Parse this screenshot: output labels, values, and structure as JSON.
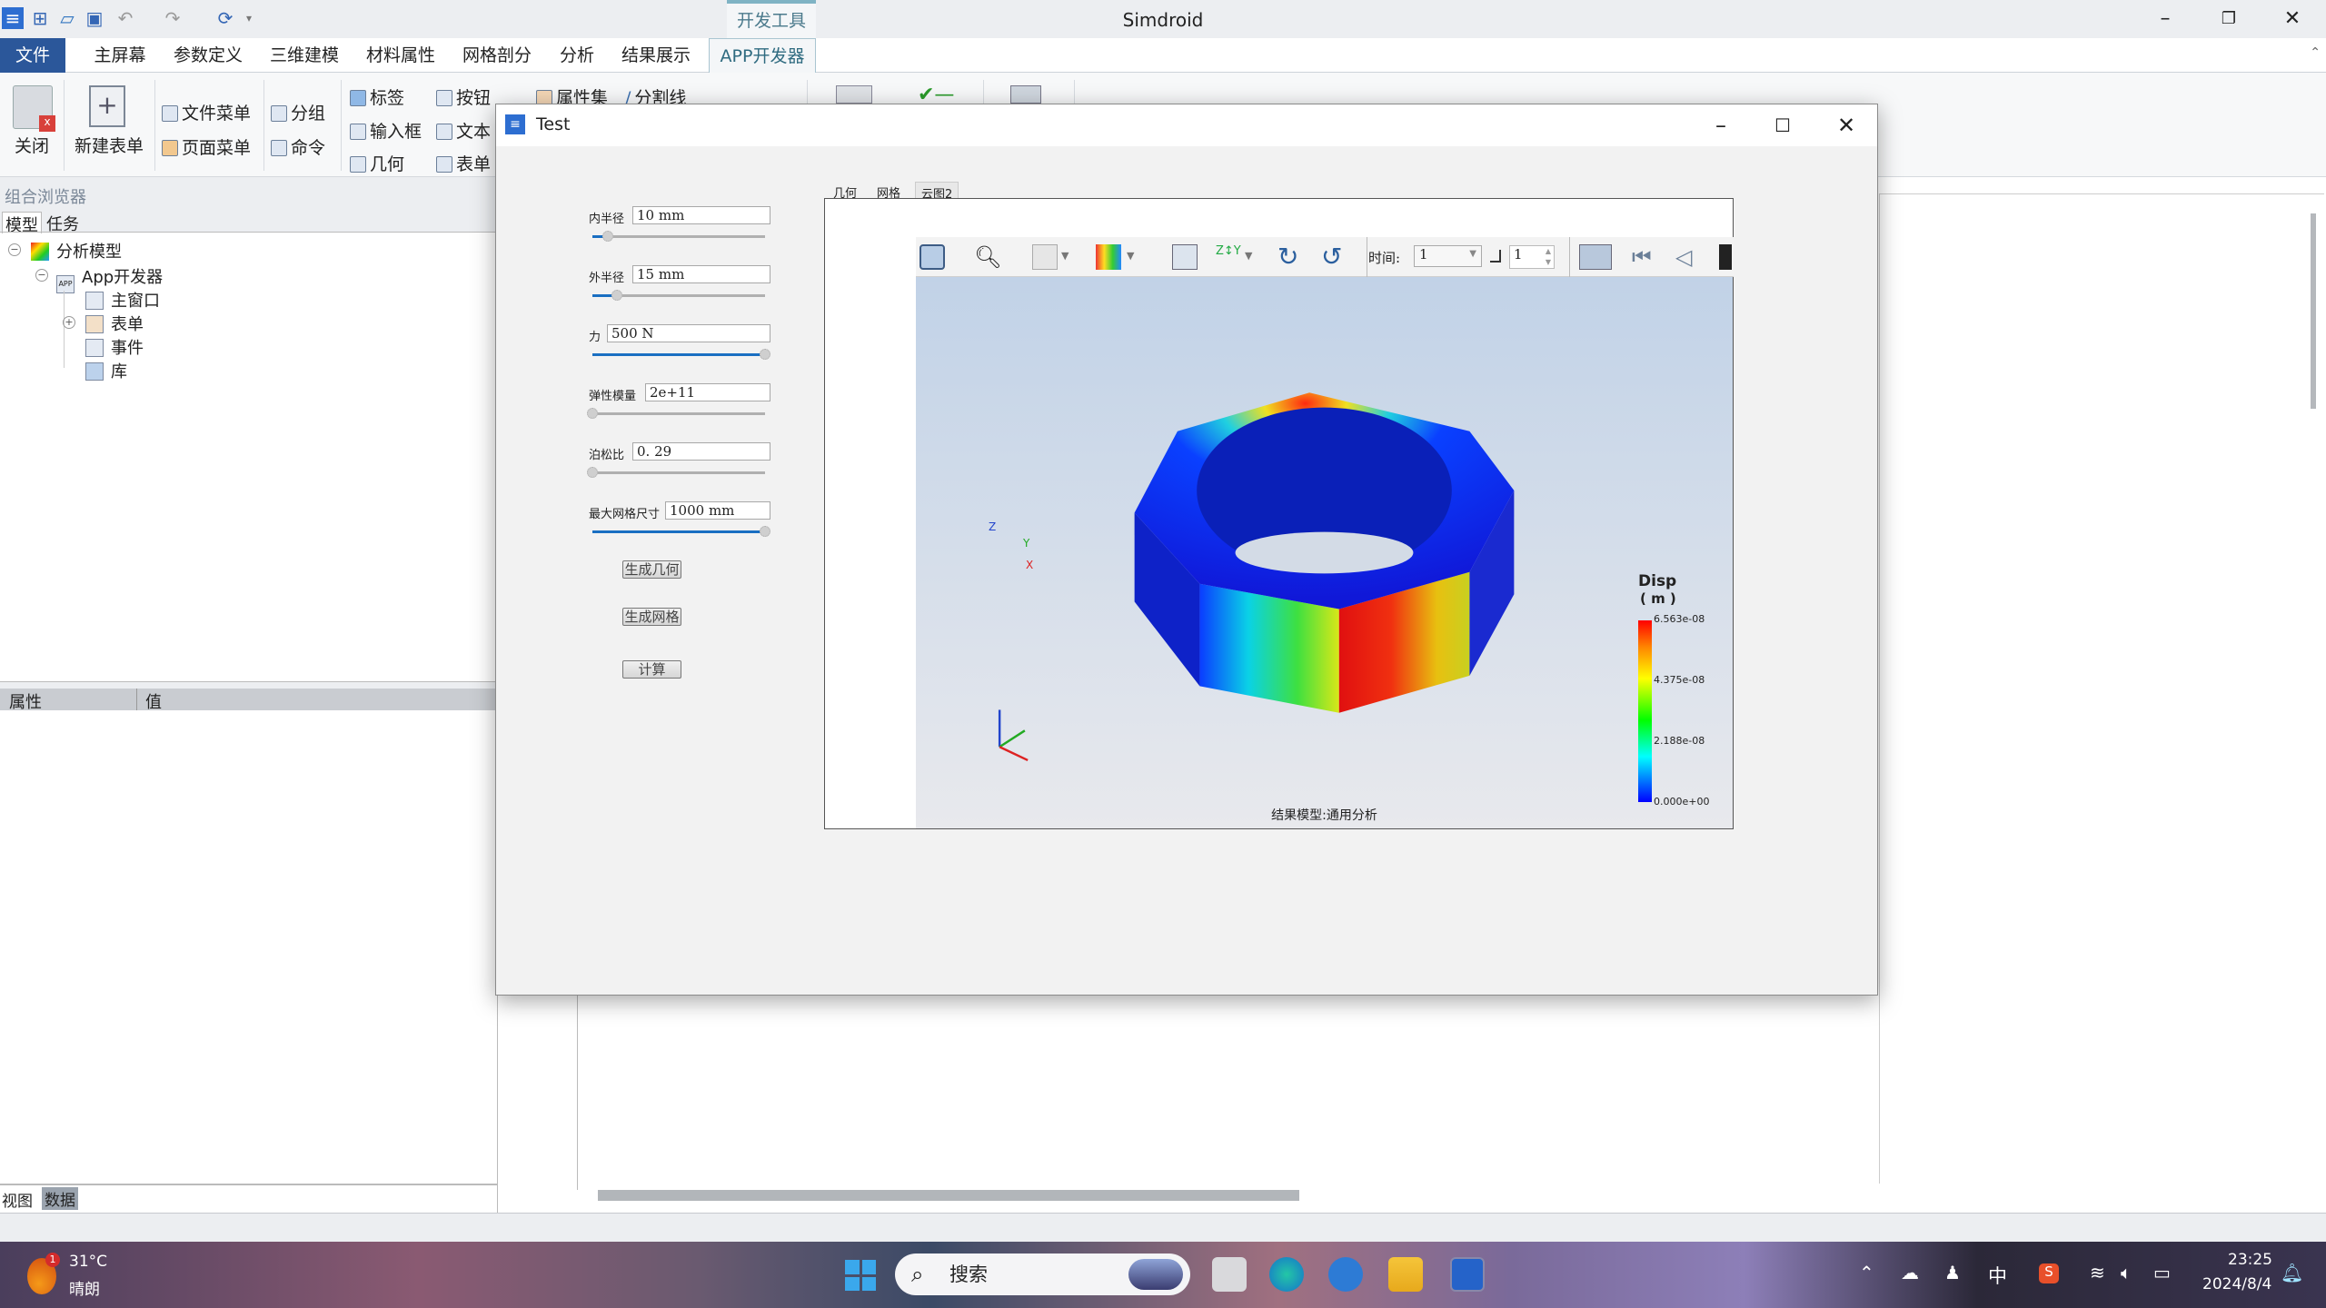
{
  "app": {
    "title": "Simdroid",
    "context_tab": "开发工具"
  },
  "menu": [
    "文件",
    "主屏幕",
    "参数定义",
    "三维建模",
    "材料属性",
    "网格剖分",
    "分析",
    "结果展示",
    "APP开发器"
  ],
  "ribbon": {
    "close": "关闭",
    "new_form": "新建表单",
    "file_menu": "文件菜单",
    "page_menu": "页面菜单",
    "group": "分组",
    "command": "命令",
    "label": "标签",
    "input_box": "输入框",
    "geometry": "几何",
    "button": "按钮",
    "text": "文本",
    "form": "表单",
    "property_set": "属性集",
    "divider": "分割线"
  },
  "left_panel": {
    "title": "组合浏览器",
    "tabs": [
      "模型",
      "任务"
    ],
    "tree": [
      {
        "label": "分析模型"
      },
      {
        "label": "App开发器"
      },
      {
        "label": "主窗口"
      },
      {
        "label": "表单"
      },
      {
        "label": "事件"
      },
      {
        "label": "库"
      }
    ],
    "prop_headers": [
      "属性",
      "值"
    ],
    "bottom_tabs": [
      "视图",
      "数据"
    ]
  },
  "dialog": {
    "title": "Test",
    "fields": [
      {
        "label": "内半径",
        "value": "10  mm",
        "slider": 0.09
      },
      {
        "label": "外半径",
        "value": "15  mm",
        "slider": 0.14
      },
      {
        "label": "力",
        "value": "500  N",
        "slider": 1.0
      },
      {
        "label": "弹性模量",
        "value": "2e+11",
        "slider": 0.0
      },
      {
        "label": "泊松比",
        "value": "0. 29",
        "slider": 0.0
      },
      {
        "label": "最大网格尺寸",
        "value": "1000  mm",
        "slider": 1.0
      }
    ],
    "buttons": [
      "生成几何",
      "生成网格",
      "计算"
    ],
    "view_tabs": [
      "几何",
      "网格",
      "云图2"
    ],
    "toolbar": {
      "time_label": "时间:",
      "time_value": "1",
      "step_value": "1"
    },
    "legend": {
      "title": "Disp",
      "unit": "( m )",
      "ticks": [
        "6.563e-08",
        "4.375e-08",
        "2.188e-08",
        "0.000e+00"
      ]
    },
    "caption": "结果模型:通用分析",
    "axes": {
      "z": "Z",
      "y": "Y",
      "x": "X"
    }
  },
  "taskbar": {
    "weather_temp": "31°C",
    "weather_desc": "晴朗",
    "weather_badge": "1",
    "search_placeholder": "搜索",
    "ime": "中",
    "time": "23:25",
    "date": "2024/8/4"
  }
}
